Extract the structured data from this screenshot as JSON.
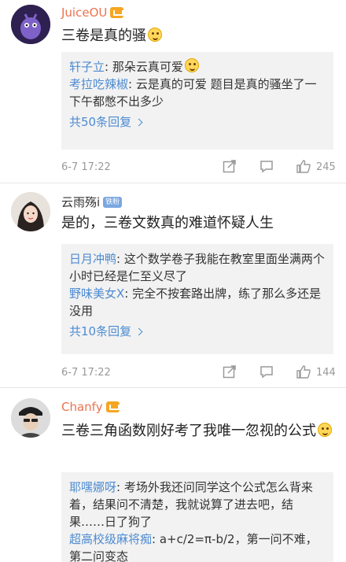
{
  "comments": [
    {
      "user": "JuiceOU",
      "text": "三卷是真的骚",
      "replies": [
        {
          "name": "轩子立",
          "text": "那朵云真可爱"
        },
        {
          "name": "考拉吃辣椒",
          "text": "云是真的可爱 题目是真的骚坐了一下午都憋不出多少"
        }
      ],
      "more": "共50条回复",
      "time": "6-7 17:22",
      "likes": "245"
    },
    {
      "user": "云雨殇i",
      "badge": "铁粉",
      "text": "是的，三卷文数真的难道怀疑人生",
      "replies": [
        {
          "name": "日月冲鸭",
          "text": "这个数学卷子我能在教室里面坐满两个小时已经是仁至义尽了"
        },
        {
          "name": "野味美女X",
          "text": "完全不按套路出牌，练了那么多还是没用"
        }
      ],
      "more": "共10条回复",
      "time": "6-7 17:22",
      "likes": "144"
    },
    {
      "user": "Chanfy",
      "text": "三卷三角函数刚好考了我唯一忽视的公式",
      "replies": [
        {
          "name": "耶嘿娜呀",
          "text": "考场外我还问同学这个公式怎么背来着，结果问不清楚，我就说算了进去吧，结果……日了狗了"
        },
        {
          "name": "超高校级麻将痴",
          "text": "a+c/2=π-b/2，第一问不难，第二问变态"
        }
      ]
    }
  ],
  "colors": {
    "name_orange": "#eb7350",
    "link_blue": "#4d8bd1",
    "reply_bg": "#f2f2f2"
  },
  "icons": [
    "share-icon",
    "comment-icon",
    "like-icon",
    "vip-icon"
  ]
}
